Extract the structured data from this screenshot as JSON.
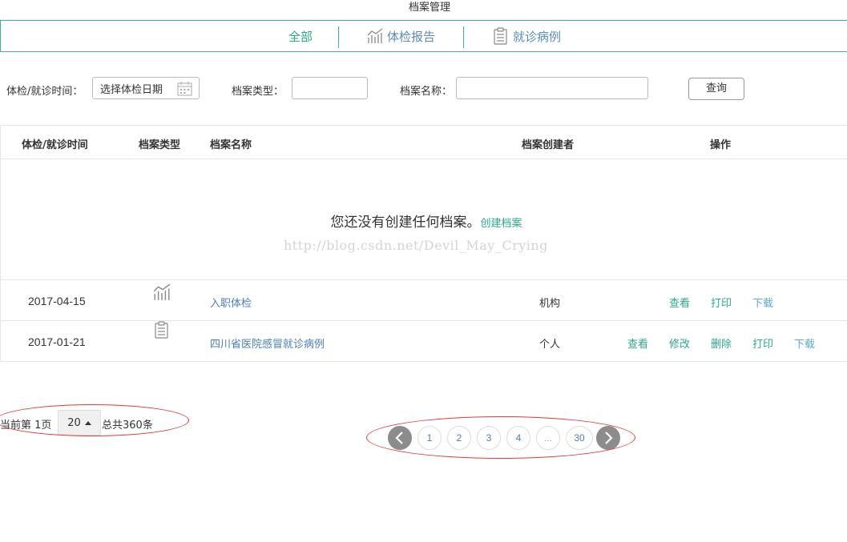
{
  "page": {
    "title": "档案管理"
  },
  "tabs": [
    {
      "label": "全部",
      "icon": null,
      "active": true
    },
    {
      "label": "体检报告",
      "icon": "chart-icon",
      "active": false
    },
    {
      "label": "就诊病例",
      "icon": "clipboard-icon",
      "active": false
    }
  ],
  "filter": {
    "time_label": "体检/就诊时间：",
    "date_placeholder": "选择体检日期",
    "type_label": "档案类型：",
    "type_value": "",
    "name_label": "档案名称：",
    "name_value": "",
    "query_label": "查询"
  },
  "table": {
    "headers": [
      "体检/就诊时间",
      "档案类型",
      "档案名称",
      "档案创建者",
      "操作"
    ],
    "empty_message": "您还没有创建任何档案。",
    "create_link": "创建档案",
    "watermark": "http://blog.csdn.net/Devil_May_Crying",
    "rows": [
      {
        "date": "2017-04-15",
        "type_icon": "chart-icon",
        "name": "入职体检",
        "owner": "机构",
        "actions": [
          "查看",
          "打印",
          "下载"
        ]
      },
      {
        "date": "2017-01-21",
        "type_icon": "clipboard-icon",
        "name": "四川省医院感冒就诊病例",
        "owner": "个人",
        "actions": [
          "查看",
          "修改",
          "删除",
          "打印",
          "下载"
        ]
      }
    ]
  },
  "pager": {
    "current_text": "当前第 1页",
    "page_size": "20",
    "total_text": "总共360条",
    "pages": [
      "1",
      "2",
      "3",
      "4",
      "...",
      "30"
    ],
    "prev_icon": "chevron-left-icon",
    "next_icon": "chevron-right-icon"
  },
  "colors": {
    "accent_green": "#2aaa8a",
    "link_blue": "#4a7fb5",
    "annotation_red": "#e23a3a"
  }
}
